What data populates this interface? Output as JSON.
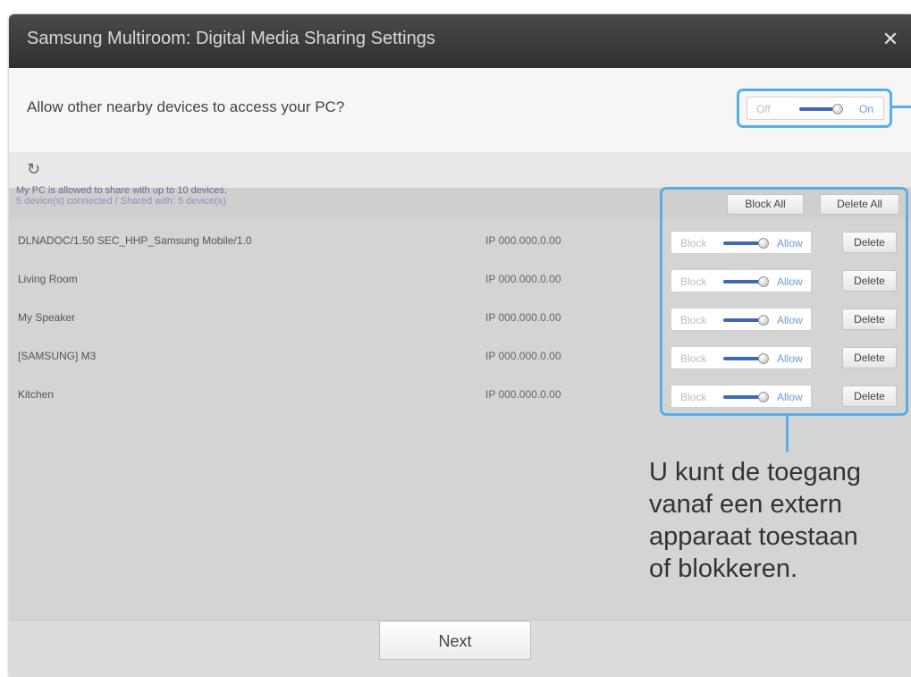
{
  "window": {
    "title": "Samsung Multiroom: Digital Media Sharing Settings",
    "close_symbol": "✕"
  },
  "access": {
    "question": "Allow other nearby devices to access your PC?",
    "toggle_off_label": "Off",
    "toggle_on_label": "On",
    "state": "On"
  },
  "refresh_icon": "refresh-icon",
  "share_info": {
    "line1": "My PC is allowed to share with up to 10 devices.",
    "line2": "5 device(s) connected / Shared with: 5 device(s)"
  },
  "actions": {
    "block_all": "Block All",
    "delete_all": "Delete All"
  },
  "devices": [
    {
      "name": "DLNADOC/1.50 SEC_HHP_Samsung Mobile/1.0",
      "ip": "IP 000.000.0.00",
      "block_label": "Block",
      "allow_label": "Allow",
      "state": "Allow",
      "delete_label": "Delete"
    },
    {
      "name": "Living Room",
      "ip": "IP 000.000.0.00",
      "block_label": "Block",
      "allow_label": "Allow",
      "state": "Allow",
      "delete_label": "Delete"
    },
    {
      "name": "My Speaker",
      "ip": "IP 000.000.0.00",
      "block_label": "Block",
      "allow_label": "Allow",
      "state": "Allow",
      "delete_label": "Delete"
    },
    {
      "name": "[SAMSUNG] M3",
      "ip": "IP 000.000.0.00",
      "block_label": "Block",
      "allow_label": "Allow",
      "state": "Allow",
      "delete_label": "Delete"
    },
    {
      "name": "Kitchen",
      "ip": "IP 000.000.0.00",
      "block_label": "Block",
      "allow_label": "Allow",
      "state": "Allow",
      "delete_label": "Delete"
    }
  ],
  "annotation": {
    "line1": "U kunt de toegang",
    "line2": "vanaf een extern",
    "line3": "apparaat toestaan",
    "line4": "of blokkeren."
  },
  "footer": {
    "next_label": "Next"
  },
  "colors": {
    "highlight": "#5aaee6",
    "toggle_track": "#3f68b5",
    "titlebar": "#3a3a3a"
  }
}
